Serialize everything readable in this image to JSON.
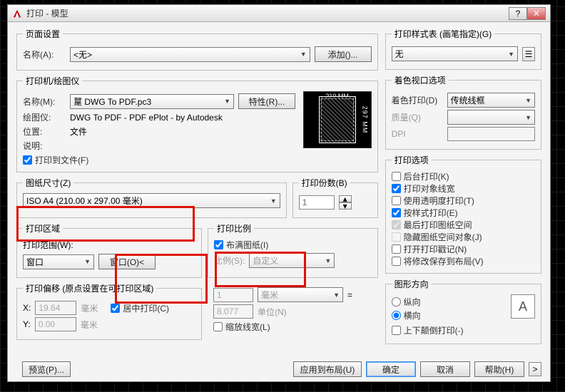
{
  "window": {
    "title": "打印 - 模型"
  },
  "page_setup": {
    "legend": "页面设置",
    "name_label": "名称(A):",
    "name_value": "<无>",
    "add_btn": "添加()..."
  },
  "printer": {
    "legend": "打印机/绘图仪",
    "name_label": "名称(M):",
    "name_value": "翨 DWG To PDF.pc3",
    "props_btn": "特性(R)...",
    "plotter_label": "绘图仪:",
    "plotter_value": "DWG To PDF - PDF ePlot - by Autodesk",
    "where_label": "位置:",
    "where_value": "文件",
    "desc_label": "说明:",
    "plot_to_file": "打印到文件(F)",
    "preview_top": "210 MM",
    "preview_side": "297 MM"
  },
  "paper": {
    "legend": "图纸尺寸(Z)",
    "value": "ISO A4 (210.00 x 297.00 毫米)"
  },
  "copies": {
    "legend": "打印份数(B)",
    "value": "1"
  },
  "area": {
    "legend": "打印区域",
    "range_label": "打印范围(W):",
    "range_value": "窗口",
    "window_btn": "窗口(O)<"
  },
  "scale": {
    "legend": "打印比例",
    "fit": "布满图纸(I)",
    "ratio_label": "比例(S):",
    "ratio_value": "自定义",
    "num": "1",
    "num_unit": "毫米",
    "den": "8.077",
    "den_unit": "单位(N)",
    "scale_lw": "缩放线宽(L)"
  },
  "offset": {
    "legend": "打印偏移 (原点设置在可打印区域)",
    "x_label": "X:",
    "x_value": "19.64",
    "unit": "毫米",
    "y_label": "Y:",
    "y_value": "0.00",
    "center": "居中打印(C)"
  },
  "style": {
    "legend": "打印样式表 (画笔指定)(G)",
    "value": "无"
  },
  "shade": {
    "legend": "着色视口选项",
    "shade_label": "着色打印(D)",
    "shade_value": "传统线框",
    "quality_label": "质量(Q)",
    "dpi_label": "DPI"
  },
  "options": {
    "legend": "打印选项",
    "bg": "后台打印(K)",
    "obj_lw": "打印对象线宽",
    "transp": "使用透明度打印(T)",
    "styles": "按样式打印(E)",
    "paperspace_last": "最后打印图纸空间",
    "hide_ps": "隐藏图纸空间对象(J)",
    "stamp": "打开打印戳记(N)",
    "save_layout": "将修改保存到布局(V)"
  },
  "orientation": {
    "legend": "图形方向",
    "portrait": "纵向",
    "landscape": "横向",
    "upside": "上下颠倒打印(-)",
    "icon": "A"
  },
  "buttons": {
    "preview": "预览(P)...",
    "apply": "应用到布局(U)",
    "ok": "确定",
    "cancel": "取消",
    "help": "帮助(H)",
    "expand": ">"
  }
}
